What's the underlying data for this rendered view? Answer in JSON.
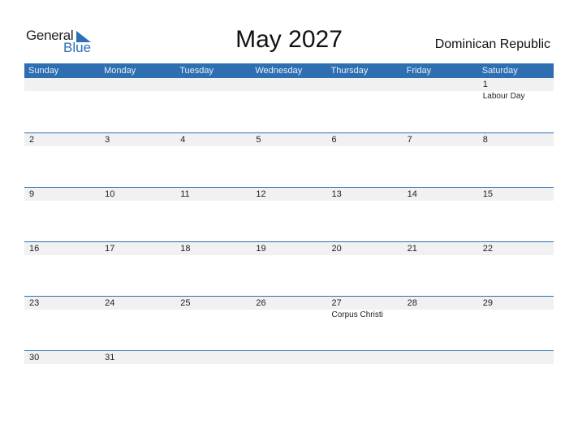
{
  "brand": {
    "general": "General",
    "blue": "Blue"
  },
  "title": "May 2027",
  "country": "Dominican Republic",
  "colors": {
    "header": "#2e6fb2",
    "band": "#f1f1f1"
  },
  "weekdays": [
    "Sunday",
    "Monday",
    "Tuesday",
    "Wednesday",
    "Thursday",
    "Friday",
    "Saturday"
  ],
  "weeks": [
    [
      {
        "d": ""
      },
      {
        "d": ""
      },
      {
        "d": ""
      },
      {
        "d": ""
      },
      {
        "d": ""
      },
      {
        "d": ""
      },
      {
        "d": "1",
        "e": "Labour Day"
      }
    ],
    [
      {
        "d": "2"
      },
      {
        "d": "3"
      },
      {
        "d": "4"
      },
      {
        "d": "5"
      },
      {
        "d": "6"
      },
      {
        "d": "7"
      },
      {
        "d": "8"
      }
    ],
    [
      {
        "d": "9"
      },
      {
        "d": "10"
      },
      {
        "d": "11"
      },
      {
        "d": "12"
      },
      {
        "d": "13"
      },
      {
        "d": "14"
      },
      {
        "d": "15"
      }
    ],
    [
      {
        "d": "16"
      },
      {
        "d": "17"
      },
      {
        "d": "18"
      },
      {
        "d": "19"
      },
      {
        "d": "20"
      },
      {
        "d": "21"
      },
      {
        "d": "22"
      }
    ],
    [
      {
        "d": "23"
      },
      {
        "d": "24"
      },
      {
        "d": "25"
      },
      {
        "d": "26"
      },
      {
        "d": "27",
        "e": "Corpus Christi"
      },
      {
        "d": "28"
      },
      {
        "d": "29"
      }
    ],
    [
      {
        "d": "30"
      },
      {
        "d": "31"
      },
      {
        "d": ""
      },
      {
        "d": ""
      },
      {
        "d": ""
      },
      {
        "d": ""
      },
      {
        "d": ""
      }
    ]
  ]
}
